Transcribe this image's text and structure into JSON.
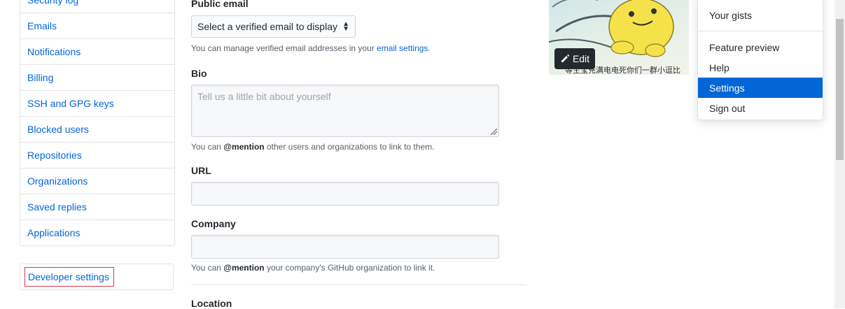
{
  "sidebar": {
    "items": [
      {
        "label": "Security log"
      },
      {
        "label": "Emails"
      },
      {
        "label": "Notifications"
      },
      {
        "label": "Billing"
      },
      {
        "label": "SSH and GPG keys"
      },
      {
        "label": "Blocked users"
      },
      {
        "label": "Repositories"
      },
      {
        "label": "Organizations"
      },
      {
        "label": "Saved replies"
      },
      {
        "label": "Applications"
      }
    ],
    "developer_settings": "Developer settings"
  },
  "form": {
    "public_email": {
      "label": "Public email",
      "selected": "Select a verified email to display",
      "note_prefix": "You can manage verified email addresses in your ",
      "note_link": "email settings",
      "note_suffix": "."
    },
    "bio": {
      "label": "Bio",
      "placeholder": "Tell us a little bit about yourself",
      "note_prefix": "You can ",
      "note_mention": "@mention",
      "note_suffix": " other users and organizations to link to them."
    },
    "url": {
      "label": "URL",
      "value": ""
    },
    "company": {
      "label": "Company",
      "value": "",
      "note_prefix": "You can ",
      "note_mention": "@mention",
      "note_suffix": " your company's GitHub organization to link it."
    },
    "location": {
      "label": "Location"
    }
  },
  "avatar": {
    "edit_label": "Edit",
    "caption": "等主宝充满电电死你们一群小逗比"
  },
  "dropdown": {
    "top_item": "Your gists",
    "items": [
      {
        "label": "Feature preview"
      },
      {
        "label": "Help"
      },
      {
        "label": "Settings"
      },
      {
        "label": "Sign out"
      }
    ]
  },
  "colors": {
    "link": "#0366d6",
    "active_bg": "#0366d6",
    "highlight_border": "#d73a49"
  },
  "icons": [
    "pencil-icon",
    "select-caret-icon",
    "resize-handle-icon"
  ]
}
